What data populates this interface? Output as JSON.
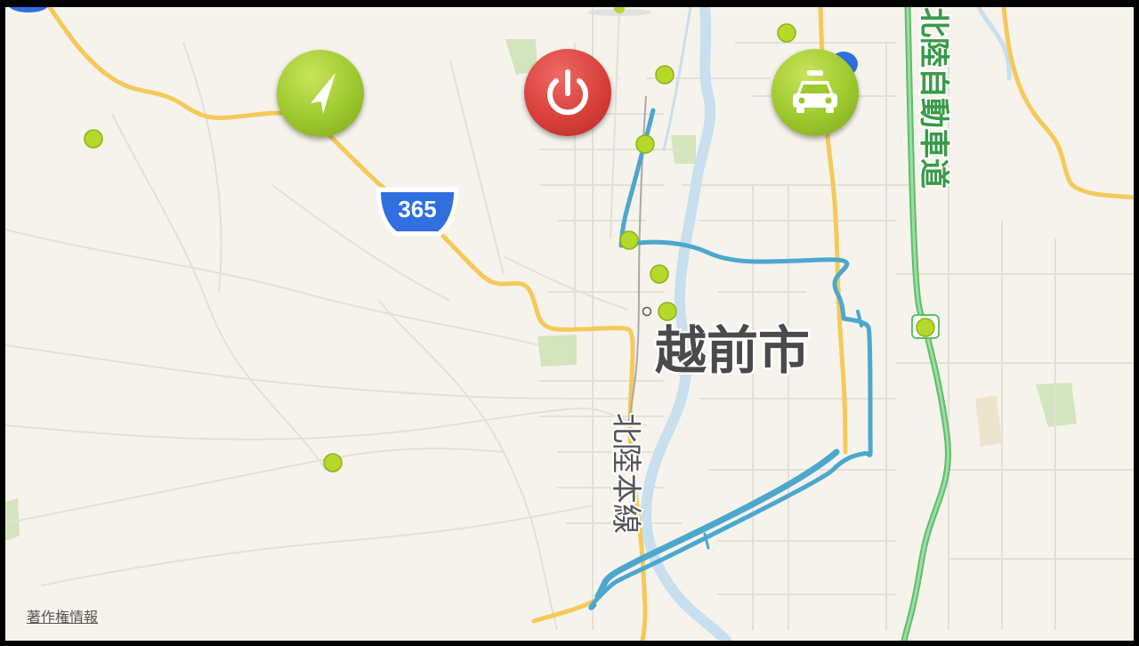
{
  "map": {
    "city_label": "越前市",
    "rail_label": "北陸本線",
    "expressway_label": "北陸自動車道",
    "route_shield": "365",
    "copyright_link": "著作権情報"
  },
  "buttons": {
    "locate_icon": "navigation-arrow-icon",
    "power_icon": "power-icon",
    "taxi_icon": "taxi-icon"
  },
  "colors": {
    "land": "#f6f3ec",
    "major_road": "#f5c95a",
    "expressway": "#5cbf6a",
    "route_line": "#4ba7cd",
    "river": "#c7dfee",
    "park": "#cfe3b8",
    "shield": "#2f6fe0",
    "marker": "#b5d82a",
    "button_green": "#9cc92d",
    "button_red": "#d9403b"
  }
}
